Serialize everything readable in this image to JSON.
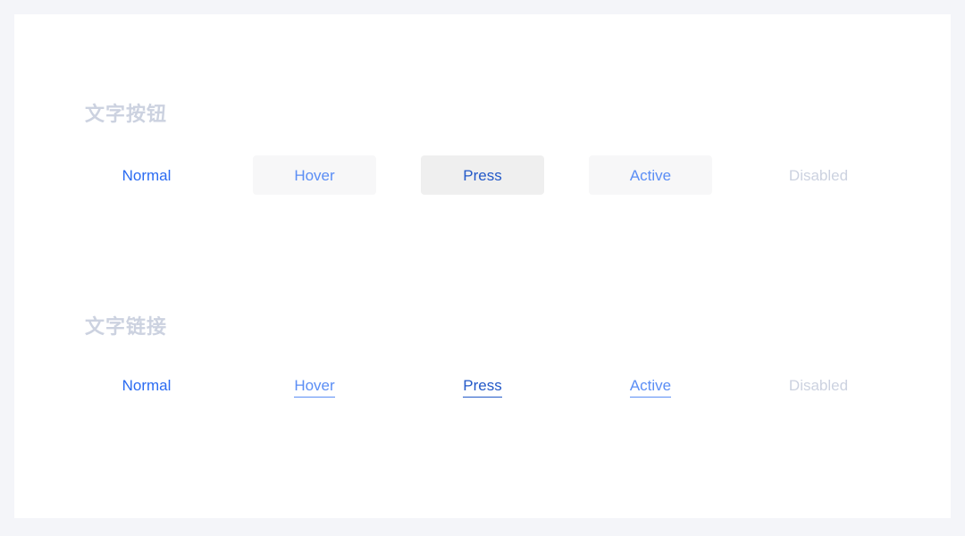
{
  "page": {
    "background_color": "#f4f5f9",
    "card_background_color": "#ffffff"
  },
  "sections": [
    {
      "id": "text-button",
      "title": "文字按钮",
      "title_color": "#ccd2e0",
      "states": [
        {
          "key": "normal",
          "label": "Normal",
          "text_color": "#2a6bf2",
          "background_color": "transparent"
        },
        {
          "key": "hover",
          "label": "Hover",
          "text_color": "#5b8ef5",
          "background_color": "#f7f7f8"
        },
        {
          "key": "press",
          "label": "Press",
          "text_color": "#2359c8",
          "background_color": "#efefef"
        },
        {
          "key": "active",
          "label": "Active",
          "text_color": "#5b8ef5",
          "background_color": "#f7f7f8"
        },
        {
          "key": "disabled",
          "label": "Disabled",
          "text_color": "#ccd2e0",
          "background_color": "transparent"
        }
      ]
    },
    {
      "id": "text-link",
      "title": "文字链接",
      "title_color": "#ccd2e0",
      "states": [
        {
          "key": "normal",
          "label": "Normal",
          "text_color": "#2a6bf2",
          "underline": "none"
        },
        {
          "key": "hover",
          "label": "Hover",
          "text_color": "#5b8ef5",
          "underline": "underline"
        },
        {
          "key": "press",
          "label": "Press",
          "text_color": "#2359c8",
          "underline": "underline"
        },
        {
          "key": "active",
          "label": "Active",
          "text_color": "#5b8ef5",
          "underline": "underline"
        },
        {
          "key": "disabled",
          "label": "Disabled",
          "text_color": "#ccd2e0",
          "underline": "none"
        }
      ]
    }
  ]
}
